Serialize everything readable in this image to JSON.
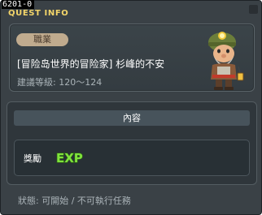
{
  "window": {
    "quest_id": "6201-0",
    "title": "QUEST INFO"
  },
  "header": {
    "job_label": "職業",
    "quest_title": "[冒险岛世界的冒险家] 杉峰的不安",
    "level_text": "建議等級: 120～124",
    "npc_icon": "miner-npc-portrait"
  },
  "content": {
    "header_label": "內容",
    "reward_label": "獎勵",
    "reward_icon_text": "EXP",
    "reward_icon": "exp-icon"
  },
  "status": {
    "text": "狀態: 可開始 / 不可執行任務"
  },
  "colors": {
    "window_bg": "#3a4146",
    "title_yellow": "#f4d66a",
    "badge_bg": "#c0ab8e",
    "exp_green": "#7fe23c"
  }
}
